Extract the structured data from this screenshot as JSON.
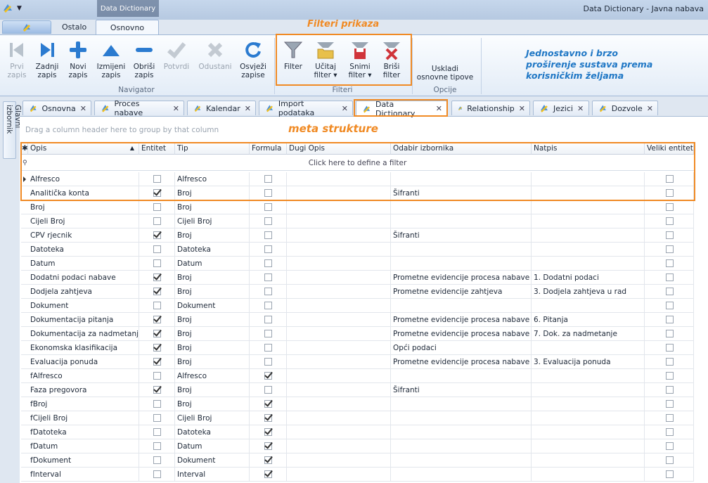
{
  "window": {
    "doc_title": "Data Dictionary",
    "app_title": "Data Dictionary - Javna nabava"
  },
  "ribbon": {
    "tabs": [
      {
        "label": "Ostalo"
      },
      {
        "label": "Osnovno"
      }
    ],
    "navigator": {
      "group_label": "Navigator",
      "buttons": [
        {
          "l1": "Prvi",
          "l2": "zapis"
        },
        {
          "l1": "Zadnji",
          "l2": "zapis"
        },
        {
          "l1": "Novi",
          "l2": "zapis"
        },
        {
          "l1": "Izmijeni",
          "l2": "zapis"
        },
        {
          "l1": "Obriši",
          "l2": "zapis"
        },
        {
          "l1": "Potvrdi",
          "l2": ""
        },
        {
          "l1": "Odustani",
          "l2": ""
        },
        {
          "l1": "Osvježi",
          "l2": "zapise"
        }
      ]
    },
    "filteri": {
      "group_label": "Filteri",
      "buttons": [
        {
          "l1": "Filter",
          "l2": ""
        },
        {
          "l1": "Učitaj",
          "l2": "filter"
        },
        {
          "l1": "Snimi",
          "l2": "filter"
        },
        {
          "l1": "Briši",
          "l2": "filter"
        }
      ]
    },
    "opcije": {
      "group_label": "Opcije",
      "button": {
        "l1": "Uskladi",
        "l2": "osnovne tipove"
      }
    }
  },
  "annotations": {
    "filteri_prikaza": "Filteri prikaza",
    "meta_strukture": "meta strukture",
    "note": "Jednostavno i brzo proširenje sustava prema korisničkim željama"
  },
  "sidebar": {
    "label": "Glavni izbornik"
  },
  "doc_tabs": [
    {
      "label": "Osnovna"
    },
    {
      "label": "Proces nabave"
    },
    {
      "label": "Kalendar"
    },
    {
      "label": "Import podataka"
    },
    {
      "label": "Data Dictionary"
    },
    {
      "label": "Relationship"
    },
    {
      "label": "Jezici"
    },
    {
      "label": "Dozvole"
    }
  ],
  "grid": {
    "group_hint": "Drag a column header here to group by that column",
    "filter_hint": "Click here to define a filter",
    "columns": [
      "Opis",
      "Entitet",
      "Tip",
      "Formula",
      "Dugi Opis",
      "Odabir izbornika",
      "Natpis",
      "Veliki entitet"
    ],
    "rows": [
      {
        "opis": "Alfresco",
        "entitet": false,
        "tip": "Alfresco",
        "formula": false,
        "dugi": "",
        "odabir": "",
        "natpis": "",
        "veliki": false
      },
      {
        "opis": "Analitička konta",
        "entitet": true,
        "tip": "Broj",
        "formula": false,
        "dugi": "",
        "odabir": "Šifranti",
        "natpis": "",
        "veliki": false
      },
      {
        "opis": "Broj",
        "entitet": false,
        "tip": "Broj",
        "formula": false,
        "dugi": "",
        "odabir": "",
        "natpis": "",
        "veliki": false
      },
      {
        "opis": "Cijeli Broj",
        "entitet": false,
        "tip": "Cijeli Broj",
        "formula": false,
        "dugi": "",
        "odabir": "",
        "natpis": "",
        "veliki": false
      },
      {
        "opis": "CPV rjecnik",
        "entitet": true,
        "tip": "Broj",
        "formula": false,
        "dugi": "",
        "odabir": "Šifranti",
        "natpis": "",
        "veliki": false
      },
      {
        "opis": "Datoteka",
        "entitet": false,
        "tip": "Datoteka",
        "formula": false,
        "dugi": "",
        "odabir": "",
        "natpis": "",
        "veliki": false
      },
      {
        "opis": "Datum",
        "entitet": false,
        "tip": "Datum",
        "formula": false,
        "dugi": "",
        "odabir": "",
        "natpis": "",
        "veliki": false
      },
      {
        "opis": "Dodatni podaci nabave",
        "entitet": true,
        "tip": "Broj",
        "formula": false,
        "dugi": "",
        "odabir": "Prometne evidencije procesa nabave",
        "natpis": "1. Dodatni podaci",
        "veliki": false
      },
      {
        "opis": "Dodjela zahtjeva",
        "entitet": true,
        "tip": "Broj",
        "formula": false,
        "dugi": "",
        "odabir": "Prometne evidencije zahtjeva",
        "natpis": "3. Dodjela zahtjeva u rad",
        "veliki": false
      },
      {
        "opis": "Dokument",
        "entitet": false,
        "tip": "Dokument",
        "formula": false,
        "dugi": "",
        "odabir": "",
        "natpis": "",
        "veliki": false
      },
      {
        "opis": "Dokumentacija pitanja",
        "entitet": true,
        "tip": "Broj",
        "formula": false,
        "dugi": "",
        "odabir": "Prometne evidencije procesa nabave",
        "natpis": "6. Pitanja",
        "veliki": false
      },
      {
        "opis": "Dokumentacija za nadmetanje",
        "entitet": true,
        "tip": "Broj",
        "formula": false,
        "dugi": "",
        "odabir": "Prometne evidencije procesa nabave",
        "natpis": "7. Dok. za nadmetanje",
        "veliki": false
      },
      {
        "opis": "Ekonomska klasifikacija",
        "entitet": true,
        "tip": "Broj",
        "formula": false,
        "dugi": "",
        "odabir": "Opći podaci",
        "natpis": "",
        "veliki": false
      },
      {
        "opis": "Evaluacija ponuda",
        "entitet": true,
        "tip": "Broj",
        "formula": false,
        "dugi": "",
        "odabir": "Prometne evidencije procesa nabave",
        "natpis": "3. Evaluacija ponuda",
        "veliki": false
      },
      {
        "opis": "fAlfresco",
        "entitet": false,
        "tip": "Alfresco",
        "formula": true,
        "dugi": "",
        "odabir": "",
        "natpis": "",
        "veliki": false
      },
      {
        "opis": "Faza pregovora",
        "entitet": true,
        "tip": "Broj",
        "formula": false,
        "dugi": "",
        "odabir": "Šifranti",
        "natpis": "",
        "veliki": false
      },
      {
        "opis": "fBroj",
        "entitet": false,
        "tip": "Broj",
        "formula": true,
        "dugi": "",
        "odabir": "",
        "natpis": "",
        "veliki": false
      },
      {
        "opis": "fCijeli Broj",
        "entitet": false,
        "tip": "Cijeli Broj",
        "formula": true,
        "dugi": "",
        "odabir": "",
        "natpis": "",
        "veliki": false
      },
      {
        "opis": "fDatoteka",
        "entitet": false,
        "tip": "Datoteka",
        "formula": true,
        "dugi": "",
        "odabir": "",
        "natpis": "",
        "veliki": false
      },
      {
        "opis": "fDatum",
        "entitet": false,
        "tip": "Datum",
        "formula": true,
        "dugi": "",
        "odabir": "",
        "natpis": "",
        "veliki": false
      },
      {
        "opis": "fDokument",
        "entitet": false,
        "tip": "Dokument",
        "formula": true,
        "dugi": "",
        "odabir": "",
        "natpis": "",
        "veliki": false
      },
      {
        "opis": "fInterval",
        "entitet": false,
        "tip": "Interval",
        "formula": true,
        "dugi": "",
        "odabir": "",
        "natpis": "",
        "veliki": false
      }
    ]
  },
  "colors": {
    "accent_orange": "#f08a24",
    "note_blue": "#1f77c5"
  }
}
